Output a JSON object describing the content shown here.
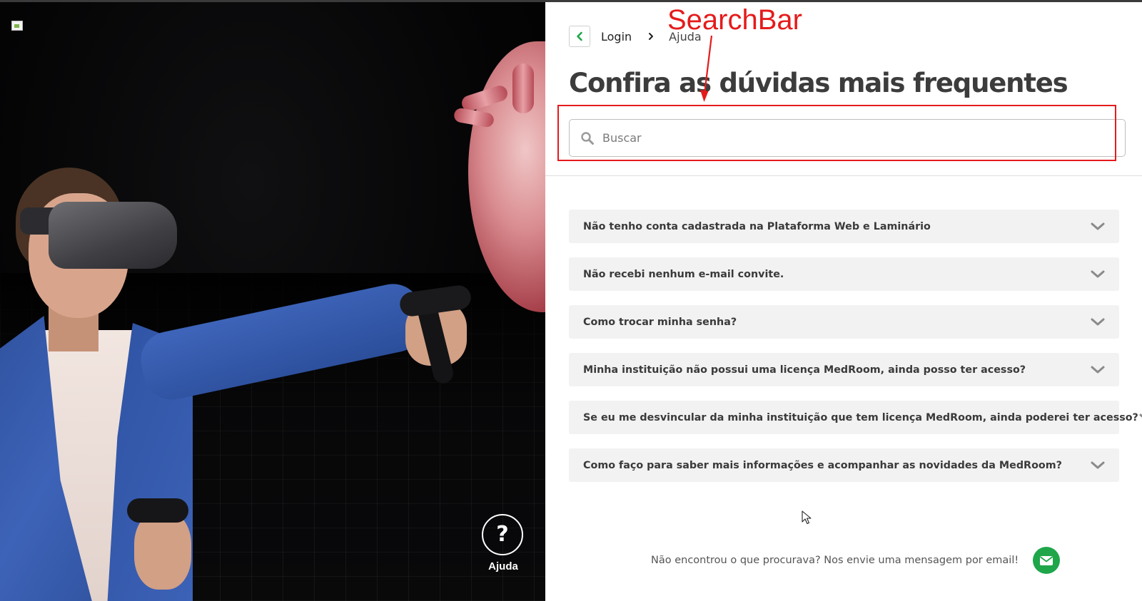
{
  "breadcrumb": {
    "login": "Login",
    "current": "Ajuda"
  },
  "page": {
    "title": "Confira as dúvidas mais frequentes"
  },
  "search": {
    "placeholder": "Buscar",
    "value": ""
  },
  "faq": [
    {
      "question": "Não tenho conta cadastrada na Plataforma Web e Laminário"
    },
    {
      "question": "Não recebi nenhum e-mail convite."
    },
    {
      "question": "Como trocar minha senha?"
    },
    {
      "question": "Minha instituição não possui uma licença MedRoom, ainda posso ter acesso?"
    },
    {
      "question": "Se eu me desvincular da minha instituição que tem licença MedRoom, ainda poderei ter acesso?"
    },
    {
      "question": "Como faço para saber mais informações e acompanhar as novidades da MedRoom?"
    }
  ],
  "footer": {
    "text": "Não encontrou o que procurava? Nos envie uma mensagem por email!"
  },
  "help": {
    "symbol": "?",
    "label": "Ajuda"
  },
  "annotation": {
    "label": "SearchBar"
  },
  "colors": {
    "accent_green": "#1fa64a",
    "annotation_red": "#e51b1b",
    "title_text": "#3c3c3c",
    "faq_background": "#f2f2f2"
  },
  "icons": {
    "back": "chevron-left-icon",
    "separator": "chevron-right-icon",
    "search": "search-icon",
    "expand": "chevron-down-icon",
    "mail": "mail-icon",
    "help": "question-icon"
  }
}
